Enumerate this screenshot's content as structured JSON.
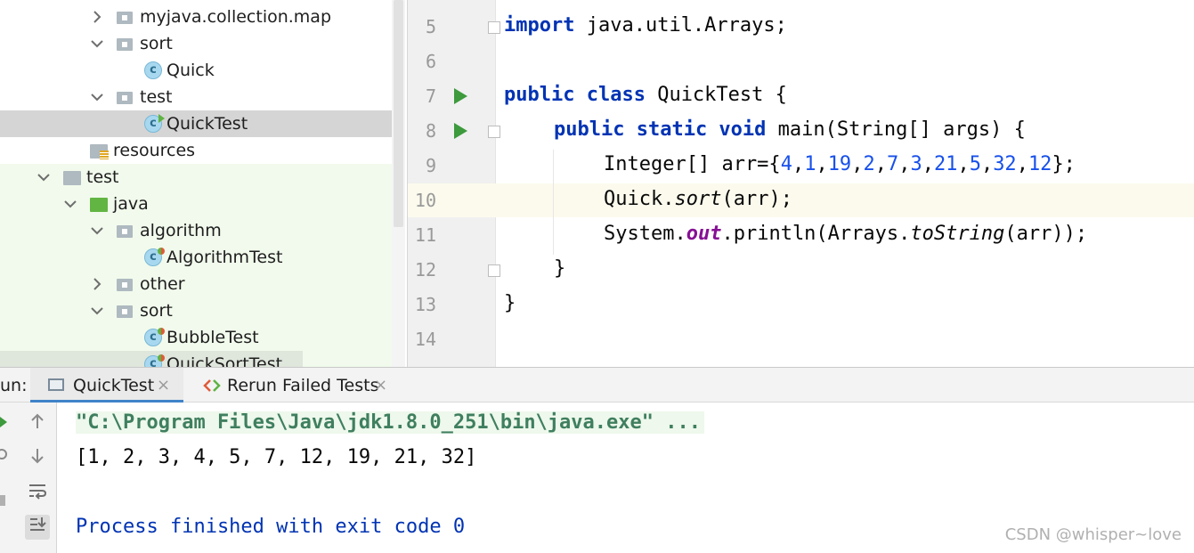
{
  "tree": {
    "items": [
      {
        "label": "myjava.collection.map",
        "icon": "package-icon",
        "arrow": "right"
      },
      {
        "label": "sort",
        "icon": "package-icon",
        "arrow": "down"
      },
      {
        "label": "Quick",
        "icon": "class-icon",
        "arrow": ""
      },
      {
        "label": "test",
        "icon": "package-icon",
        "arrow": "down"
      },
      {
        "label": "QuickTest",
        "icon": "test-class-icon",
        "arrow": "",
        "selected": true
      },
      {
        "label": "resources",
        "icon": "resources-folder-icon",
        "arrow": ""
      },
      {
        "label": "test",
        "icon": "folder-icon",
        "arrow": "down"
      },
      {
        "label": "java",
        "icon": "test-source-folder-icon",
        "arrow": "down"
      },
      {
        "label": "algorithm",
        "icon": "package-icon",
        "arrow": "down"
      },
      {
        "label": "AlgorithmTest",
        "icon": "test-class-icon",
        "arrow": ""
      },
      {
        "label": "other",
        "icon": "package-icon",
        "arrow": "right"
      },
      {
        "label": "sort",
        "icon": "package-icon",
        "arrow": "down"
      },
      {
        "label": "BubbleTest",
        "icon": "test-class-icon",
        "arrow": ""
      },
      {
        "label": "QuickSortTest",
        "icon": "test-class-icon",
        "arrow": ""
      }
    ],
    "class_glyph": "c"
  },
  "editor": {
    "line_numbers": [
      "5",
      "6",
      "7",
      "8",
      "9",
      "10",
      "11",
      "12",
      "13",
      "14"
    ],
    "current_line": "10",
    "code": {
      "l5_kw": "import",
      "l5_rest": " java.util.Arrays;",
      "l7_kw": "public class",
      "l7_rest": " QuickTest {",
      "l8_kw": "public static void",
      "l8_rest": " main(String[] args) {",
      "l9_a": "Integer[] arr={",
      "l9_nums": [
        "4",
        "1",
        "19",
        "2",
        "7",
        "3",
        "21",
        "5",
        "32",
        "12"
      ],
      "l9_end": "};",
      "l10_a": "Quick.",
      "l10_method": "sort",
      "l10_end": "(arr);",
      "l11_a": "System.",
      "l11_field": "out",
      "l11_b": ".println(Arrays.",
      "l11_method": "toString",
      "l11_end": "(arr));",
      "l12": "}",
      "l13": "}"
    }
  },
  "run_panel": {
    "label": "un:",
    "tabs": [
      {
        "label": "QuickTest",
        "active": true
      },
      {
        "label": "Rerun Failed Tests",
        "active": false
      }
    ],
    "close_glyph": "×",
    "console": {
      "command": "\"C:\\Program Files\\Java\\jdk1.8.0_251\\bin\\java.exe\" ...",
      "output": "[1, 2, 3, 4, 5, 7, 12, 19, 21, 32]",
      "exit": "Process finished with exit code 0"
    },
    "watermark": "CSDN @whisper~love"
  },
  "colors": {
    "keyword": "#0033b3",
    "number": "#1750eb",
    "field": "#871094",
    "run_green": "#3d9a3d",
    "selection": "#d5d5d5",
    "current_line": "#fcfaed"
  }
}
